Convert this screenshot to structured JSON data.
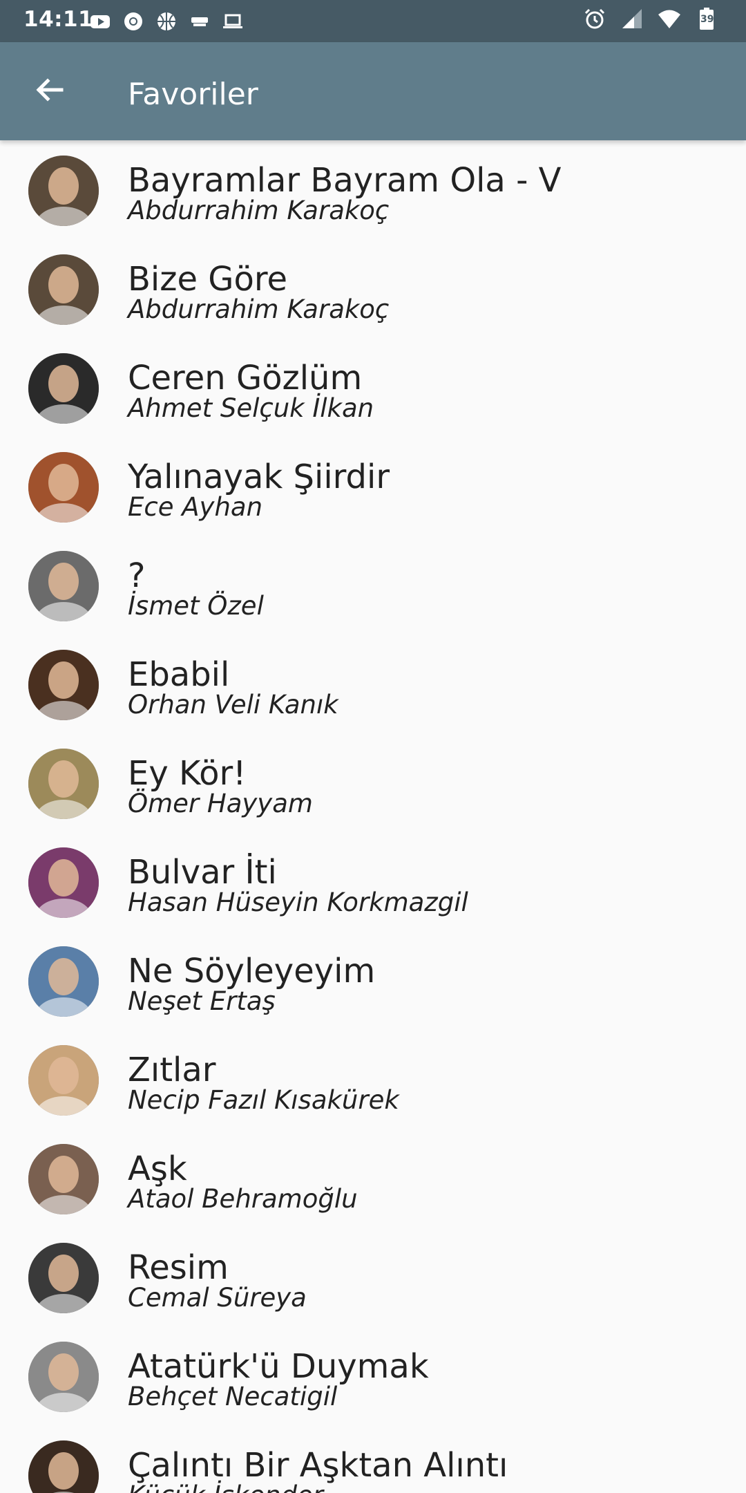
{
  "status_bar": {
    "time": "14:11",
    "left_icons": [
      "youtube-icon",
      "chrome-icon",
      "basketball-icon",
      "cast-icon",
      "laptop-icon"
    ],
    "right_icons": [
      "alarm-icon",
      "signal-icon",
      "wifi-icon",
      "battery-icon"
    ],
    "battery_level": "39"
  },
  "app_bar": {
    "title": "Favoriler",
    "back_icon": "arrow-back-icon",
    "background_color": "#607d8b"
  },
  "favorites": [
    {
      "title": "Bayramlar Bayram Ola - V",
      "poet": "Abdurrahim Karakoç",
      "avatar_color": "#5a4a3a"
    },
    {
      "title": "Bize Göre",
      "poet": "Abdurrahim Karakoç",
      "avatar_color": "#5a4a3a"
    },
    {
      "title": "Ceren Gözlüm",
      "poet": "Ahmet Selçuk İlkan",
      "avatar_color": "#2a2a2a"
    },
    {
      "title": "Yalınayak Şiirdir",
      "poet": "Ece Ayhan",
      "avatar_color": "#a0522d"
    },
    {
      "title": "?",
      "poet": "İsmet Özel",
      "avatar_color": "#6b6b6b"
    },
    {
      "title": "Ebabil",
      "poet": "Orhan Veli Kanık",
      "avatar_color": "#4a3020"
    },
    {
      "title": "Ey Kör!",
      "poet": "Ömer Hayyam",
      "avatar_color": "#9c8a5a"
    },
    {
      "title": "Bulvar İti",
      "poet": "Hasan Hüseyin Korkmazgil",
      "avatar_color": "#7a3b6b"
    },
    {
      "title": "Ne Söyleyeyim",
      "poet": "Neşet Ertaş",
      "avatar_color": "#5a7fa8"
    },
    {
      "title": "Zıtlar",
      "poet": "Necip Fazıl Kısakürek",
      "avatar_color": "#c9a47a"
    },
    {
      "title": "Aşk",
      "poet": "Ataol Behramoğlu",
      "avatar_color": "#7a6050"
    },
    {
      "title": "Resim",
      "poet": "Cemal Süreya",
      "avatar_color": "#3a3a3a"
    },
    {
      "title": "Atatürk'ü Duymak",
      "poet": "Behçet Necatigil",
      "avatar_color": "#8a8a8a"
    },
    {
      "title": "Çalıntı Bir Aşktan Alıntı",
      "poet": "Küçük İskender",
      "avatar_color": "#3a2a20"
    }
  ]
}
